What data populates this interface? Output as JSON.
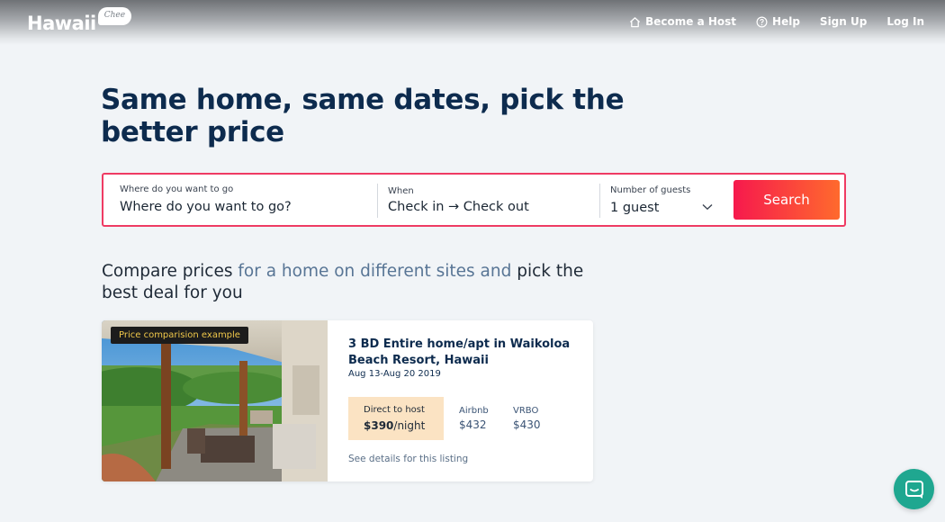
{
  "header": {
    "logo_text": "Hawaii",
    "logo_badge": "Chee",
    "nav": [
      {
        "label": "Become a Host",
        "icon": "home-icon"
      },
      {
        "label": "Help",
        "icon": "question-circle-icon"
      },
      {
        "label": "Sign Up"
      },
      {
        "label": "Log In"
      }
    ]
  },
  "hero": {
    "headline_line1": "Same home, same dates, pick the",
    "headline_line2": "better price"
  },
  "search": {
    "destination_label": "Where do you want to go",
    "destination_placeholder": "Where do you want to go?",
    "when_label": "When",
    "when_value": "Check in → Check out",
    "guests_label": "Number of guests",
    "guests_value": "1 guest",
    "button_label": "Search",
    "border_color": "#ef3b63"
  },
  "compare": {
    "part1": "Compare prices ",
    "part2": "for a home on different sites and",
    "part3": " pick the best deal for you"
  },
  "example_card": {
    "tag": "Price comparision example",
    "title": "3 BD Entire home/apt in Waikoloa Beach Resort, Hawaii",
    "dates": "Aug 13-Aug 20 2019",
    "direct_label": "Direct to host",
    "direct_price": "$390",
    "direct_unit": "/night",
    "sites": [
      {
        "name": "Airbnb",
        "price": "$432"
      },
      {
        "name": "VRBO",
        "price": "$430"
      }
    ],
    "details_link": "See details for this listing"
  },
  "chat": {
    "icon": "chat-icon",
    "color": "#1fa790"
  }
}
